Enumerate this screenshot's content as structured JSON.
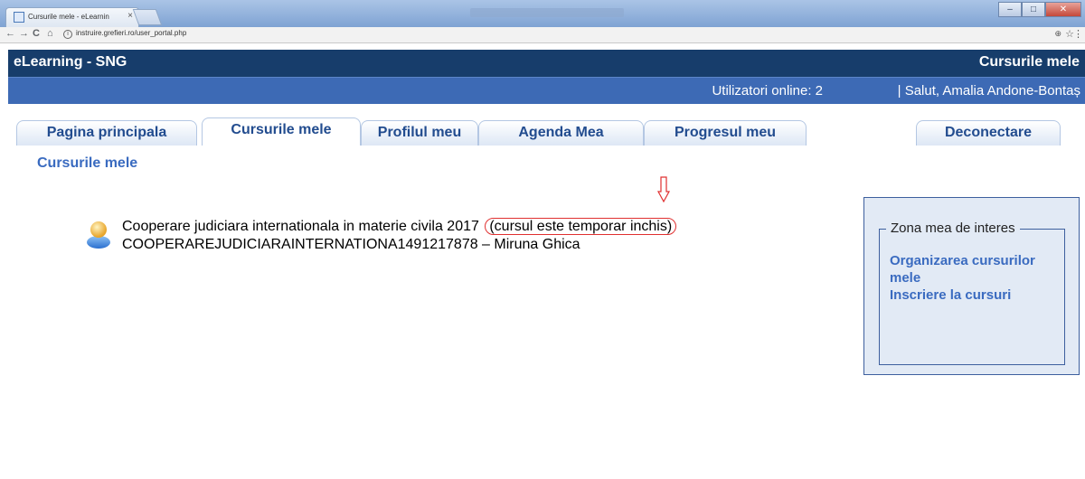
{
  "browser": {
    "tab_title": "Cursurile mele - eLearnin",
    "tab_close": "×",
    "url": "instruire.grefieri.ro/user_portal.php",
    "nav_back": "←",
    "nav_forward": "→",
    "nav_reload": "C",
    "nav_home": "⌂",
    "zoom": "⊕",
    "star": "☆",
    "menu": "⋮"
  },
  "header": {
    "brand": "eLearning - SNG",
    "section": "Cursurile mele",
    "online_label": "Utilizatori online:  2",
    "greeting": "| Salut, Amalia Andone-Bontaș"
  },
  "tabs": [
    {
      "label": "Pagina principala"
    },
    {
      "label": "Cursurile mele"
    },
    {
      "label": "Profilul meu"
    },
    {
      "label": "Agenda Mea"
    },
    {
      "label": "Progresul meu"
    },
    {
      "label": "Deconectare"
    }
  ],
  "main": {
    "heading": "Cursurile mele",
    "course": {
      "title": "Cooperare judiciara internationala in materie civila 2017",
      "status": "(cursul este temporar inchis)",
      "code_line": "COOPERAREJUDICIARAINTERNATIONA1491217878 – Miruna Ghica"
    }
  },
  "sidebar": {
    "legend": "Zona mea de interes",
    "links": [
      "Organizarea cursurilor mele",
      "Inscriere la cursuri"
    ]
  },
  "colors": {
    "header_dark": "#173d6b",
    "header_blue": "#3d6ab5",
    "link_blue": "#3a6bc0",
    "annotation_red": "#e03030"
  }
}
